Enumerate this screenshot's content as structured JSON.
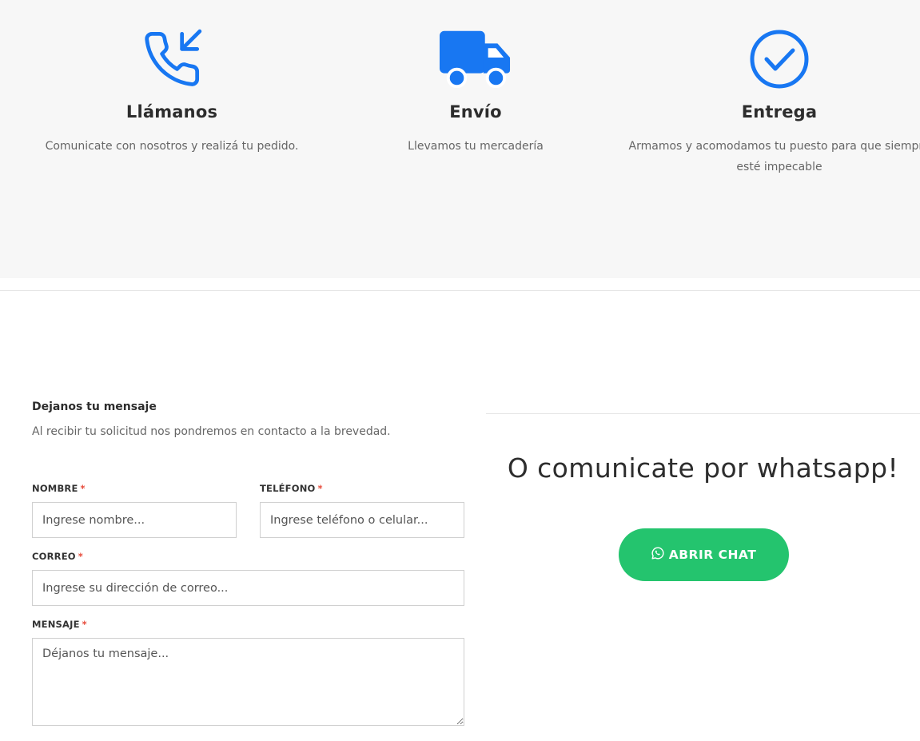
{
  "colors": {
    "accent_blue": "#1877f2",
    "whatsapp_green": "#24c46e",
    "required": "#e74c3c"
  },
  "features": [
    {
      "icon": "phone-incoming-icon",
      "title": "Llámanos",
      "text": "Comunicate con nosotros y realizá tu pedido."
    },
    {
      "icon": "truck-icon",
      "title": "Envío",
      "text": "Llevamos tu mercadería"
    },
    {
      "icon": "check-circle-icon",
      "title": "Entrega",
      "text": "Armamos y acomodamos tu puesto para que siempre esté impecable"
    }
  ],
  "form": {
    "title": "Dejanos tu mensaje",
    "subtitle": "Al recibir tu solicitud nos pondremos en contacto a la brevedad.",
    "required_mark": "*",
    "name": {
      "label": "NOMBRE",
      "placeholder": "Ingrese nombre..."
    },
    "phone": {
      "label": "TELÉFONO",
      "placeholder": "Ingrese teléfono o celular..."
    },
    "email": {
      "label": "CORREO",
      "placeholder": "Ingrese su dirección de correo..."
    },
    "message": {
      "label": "MENSAJE",
      "placeholder": "Déjanos tu mensaje..."
    }
  },
  "whatsapp": {
    "title": "O comunicate por whatsapp!",
    "button_label": "ABRIR CHAT",
    "button_icon": "whatsapp-icon"
  }
}
